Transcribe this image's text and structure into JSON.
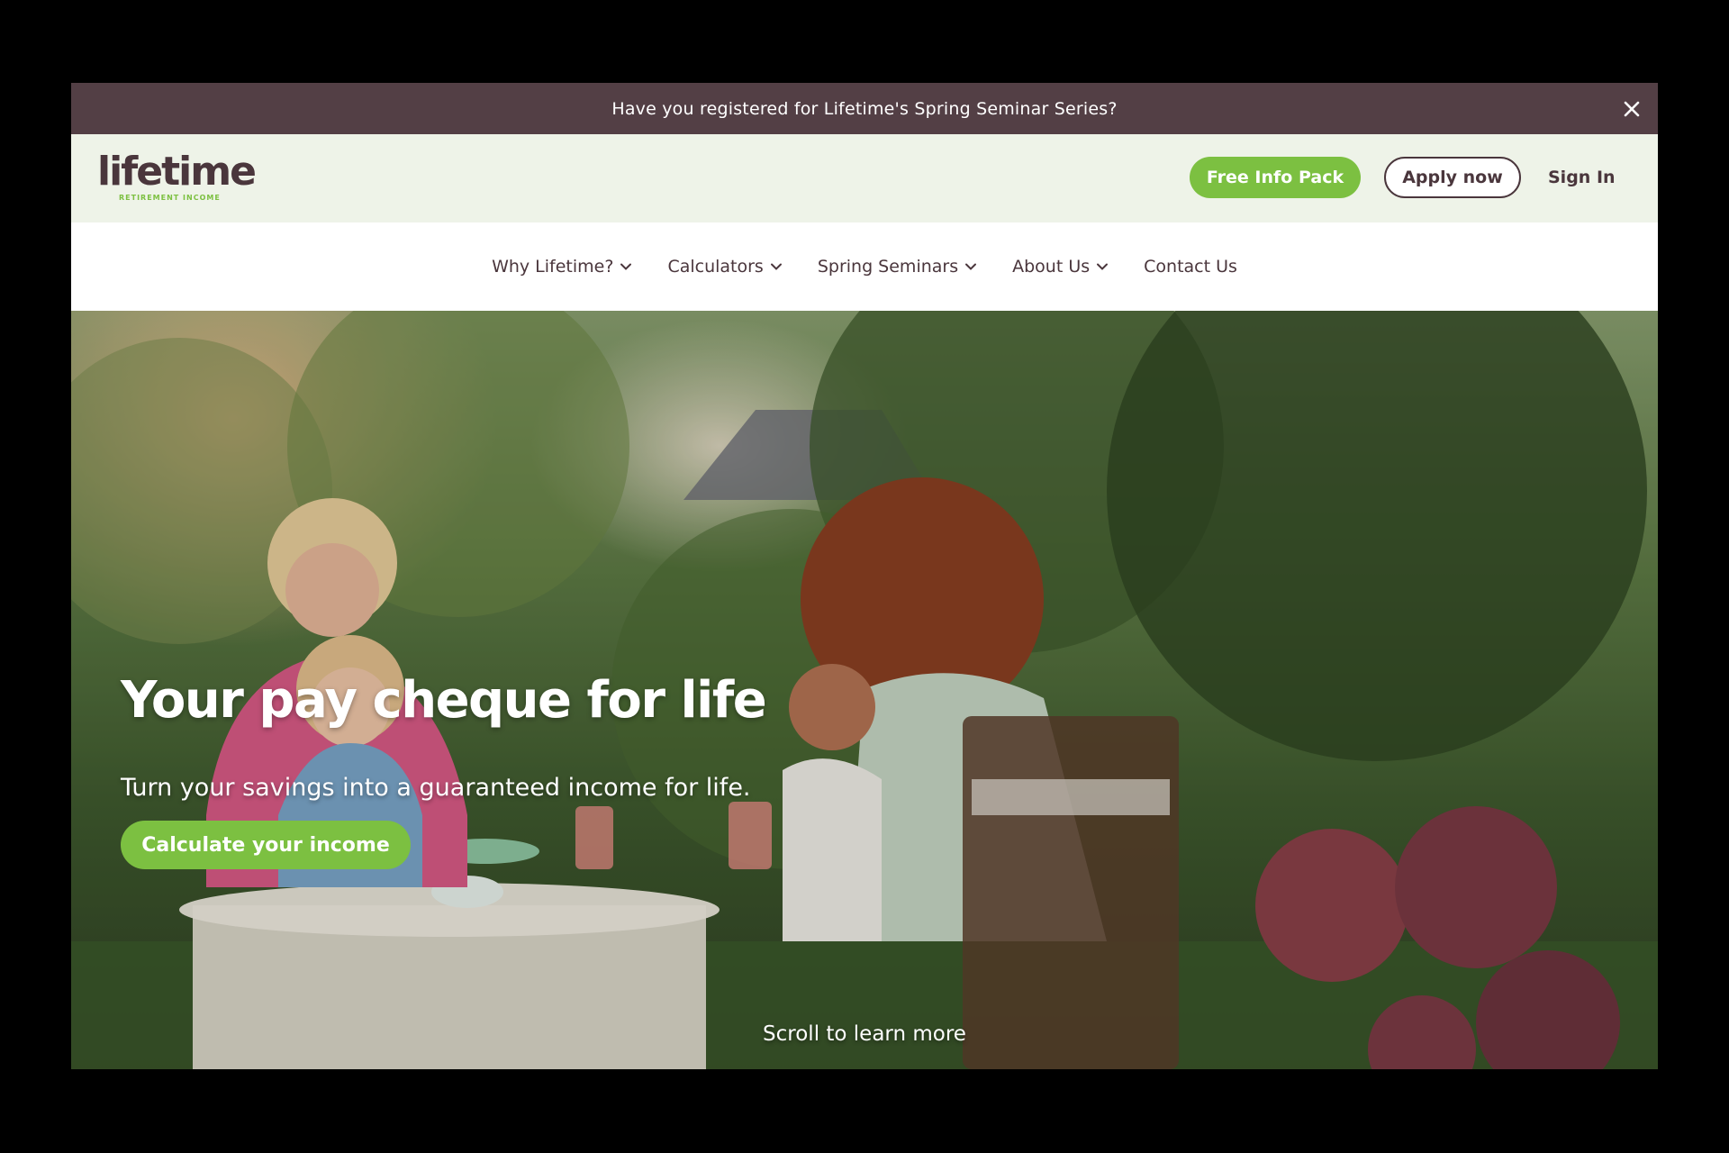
{
  "announcement": {
    "text": "Have you registered for Lifetime's Spring Seminar Series?",
    "close_icon": "close-icon"
  },
  "header": {
    "logo_text": "lifetime",
    "logo_subtext": "RETIREMENT INCOME",
    "free_info_label": "Free Info Pack",
    "apply_label": "Apply now",
    "sign_in_label": "Sign In"
  },
  "nav": {
    "items": [
      {
        "label": "Why Lifetime?",
        "has_dropdown": true
      },
      {
        "label": "Calculators",
        "has_dropdown": true
      },
      {
        "label": "Spring Seminars",
        "has_dropdown": true
      },
      {
        "label": "About Us",
        "has_dropdown": true
      },
      {
        "label": "Contact Us",
        "has_dropdown": false
      }
    ]
  },
  "hero": {
    "title": "Your pay cheque for life",
    "subtitle": "Turn your savings into a guaranteed income for life.",
    "cta_label": "Calculate your income",
    "scroll_hint": "Scroll to learn more"
  },
  "colors": {
    "announcement_bg": "#533f45",
    "header_bg": "#eef3e8",
    "brand_green": "#7cc041",
    "brand_brown": "#4a363c"
  }
}
